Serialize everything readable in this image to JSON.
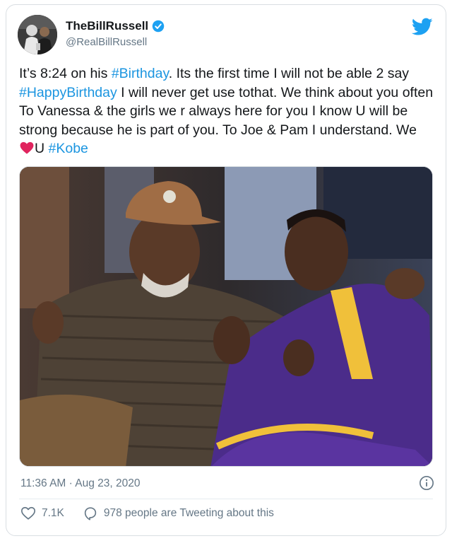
{
  "tweet": {
    "display_name": "TheBillRussell",
    "handle": "@RealBillRussell",
    "text": {
      "s1": "It’s 8:24 on his ",
      "h1": "#Birthday",
      "s2": ". Its the first time I will not be able 2 say ",
      "h2": "#HappyBirthday",
      "s3": " I will never get use tothat. We think about you often To Vanessa & the girls we r always here for you I know U will be strong because he is part of you. To Joe & Pam I understand. We ",
      "s4": "U ",
      "h3": "#Kobe"
    },
    "timestamp": "11:36 AM · Aug 23, 2020",
    "likes": "7.1K",
    "tweeting": "978 people are Tweeting about this"
  },
  "colors": {
    "link": "#1b95e0",
    "verified": "#1da1f2",
    "heart": "#e0245e",
    "muted": "#657786"
  },
  "icons": [
    "verified-badge-icon",
    "twitter-bird-icon",
    "red-heart-emoji",
    "info-icon",
    "heart-outline-icon",
    "reply-bubble-icon"
  ]
}
